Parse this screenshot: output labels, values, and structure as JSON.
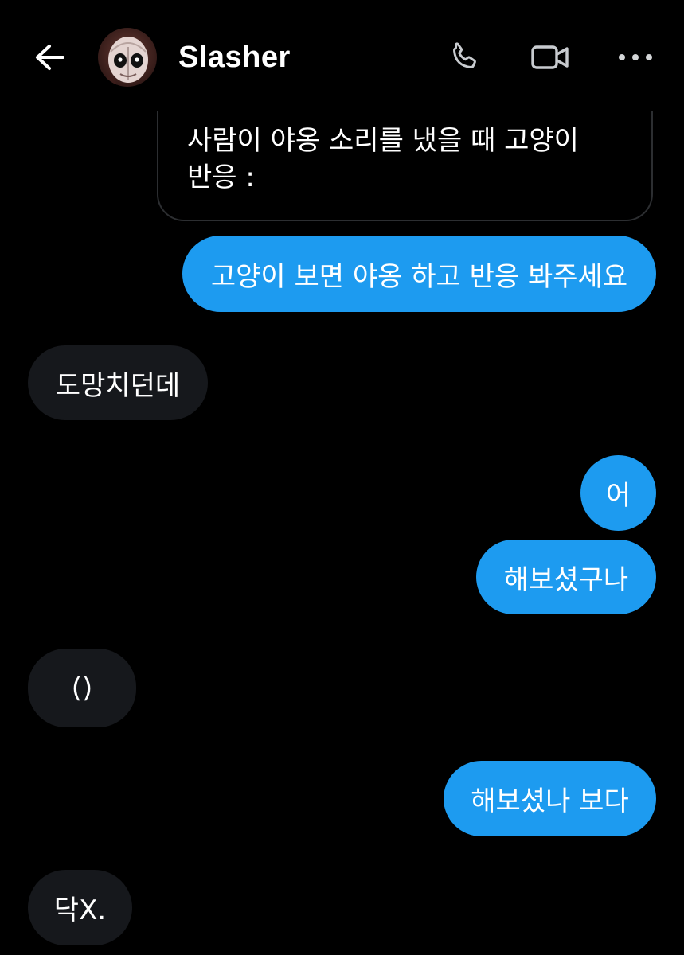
{
  "header": {
    "contact_name": "Slasher",
    "icons": {
      "back": "arrow-left-icon",
      "call": "phone-icon",
      "video": "video-camera-icon",
      "more": "more-horizontal-icon"
    }
  },
  "quoted_message": {
    "text": "사람이 야옹 소리를 냈을 때 고양이\n반응 :"
  },
  "messages": [
    {
      "direction": "sent",
      "text": "고양이 보면 야옹 하고 반응 봐주세요"
    },
    {
      "direction": "received",
      "text": "도망치던데"
    },
    {
      "direction": "sent",
      "text": "어"
    },
    {
      "direction": "sent",
      "text": "해보셨구나"
    },
    {
      "direction": "received",
      "text": "()"
    },
    {
      "direction": "sent",
      "text": "해보셨나 보다"
    },
    {
      "direction": "received",
      "text": "닥X."
    }
  ],
  "colors": {
    "background": "#000000",
    "sent_bubble": "#1d9bf0",
    "received_bubble": "#16181c",
    "icon_gray": "#c8cbcf",
    "quote_border": "#2c2e31"
  }
}
